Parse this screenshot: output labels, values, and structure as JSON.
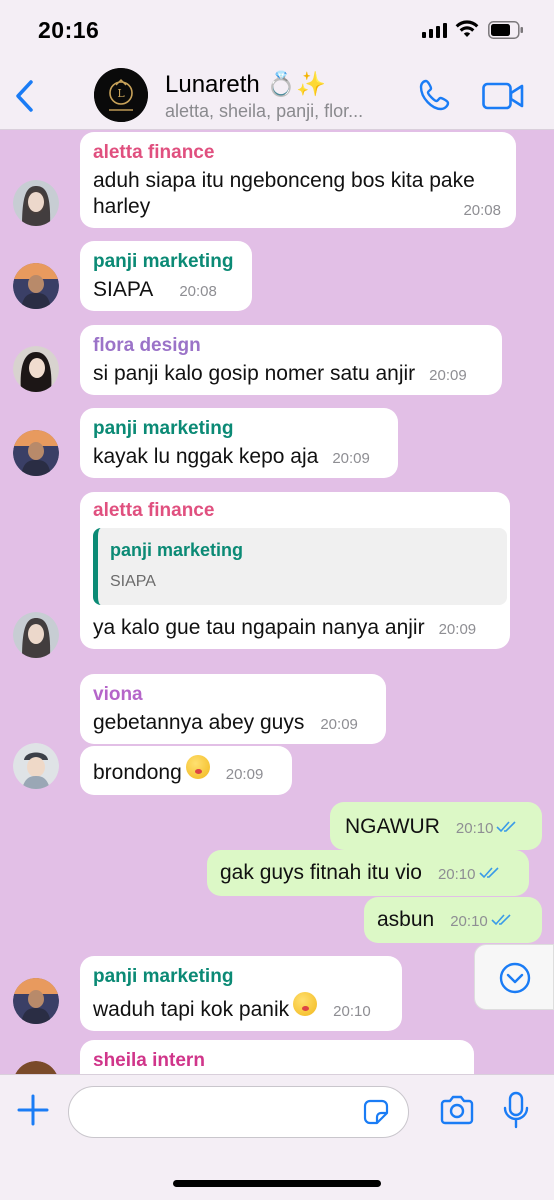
{
  "status_bar": {
    "time": "20:16"
  },
  "header": {
    "group_name": "Lunareth 💍✨",
    "members": "aletta, sheila, panji, flor..."
  },
  "colors": {
    "aletta": "#e0507f",
    "panji": "#0b8a75",
    "flora": "#9b73c8",
    "viona": "#b565c9",
    "sheila": "#d0358a",
    "chat_bg": "#e2bfe6",
    "outgoing_bubble": "#dcf8c6",
    "accent_blue": "#1a7cf5"
  },
  "messages": [
    {
      "sender": "aletta finance",
      "text": "aduh siapa itu ngebonceng bos kita pake harley",
      "time": "20:08"
    },
    {
      "sender": "panji marketing",
      "text": "SIAPA",
      "time": "20:08"
    },
    {
      "sender": "flora design",
      "text": "si panji kalo gosip nomer satu anjir",
      "time": "20:09"
    },
    {
      "sender": "panji marketing",
      "text": "kayak lu nggak kepo aja",
      "time": "20:09"
    },
    {
      "sender": "aletta finance",
      "quote_sender": "panji marketing",
      "quote_text": "SIAPA",
      "text": "ya kalo gue tau ngapain nanya anjir",
      "time": "20:09"
    },
    {
      "sender": "viona",
      "text": "gebetannya abey guys",
      "time": "20:09"
    },
    {
      "sender": "",
      "text": "brondong",
      "emoji": "face-with-hand-over-mouth",
      "time": "20:09"
    },
    {
      "outgoing": true,
      "text": "NGAWUR",
      "time": "20:10"
    },
    {
      "outgoing": true,
      "text": "gak guys fitnah itu vio",
      "time": "20:10"
    },
    {
      "outgoing": true,
      "text": "asbun",
      "time": "20:10"
    },
    {
      "sender": "panji marketing",
      "text": "waduh tapi kok panik",
      "emoji": "face-with-hand-over-mouth",
      "time": "20:10"
    },
    {
      "sender": "sheila intern",
      "text": "",
      "time": ""
    }
  ],
  "input": {
    "placeholder": ""
  },
  "icons": [
    "back-icon",
    "call-icon",
    "video-call-icon",
    "plus-icon",
    "sticker-icon",
    "camera-icon",
    "microphone-icon",
    "chevron-down-icon",
    "read-receipt-icon"
  ]
}
